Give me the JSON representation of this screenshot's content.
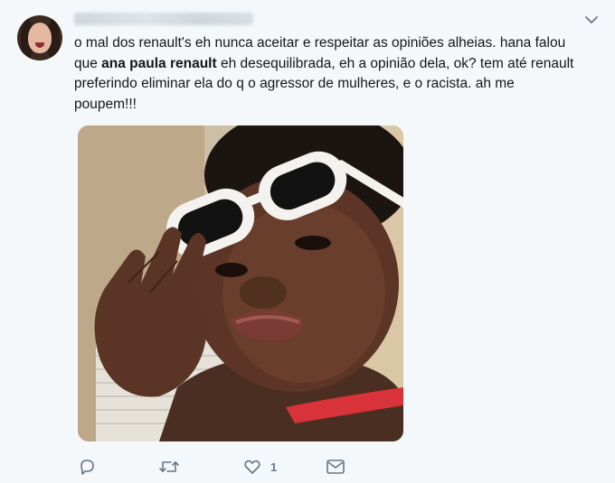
{
  "tweet": {
    "text_part1": "o mal dos renault's eh nunca aceitar e respeitar as opiniões alheias. hana falou\nque ",
    "text_bold": "ana paula renault",
    "text_part2": " eh desequilibrada, eh a opinião dela, ok? tem até renault\npreferindo eliminar ela do q o agressor de mulheres, e o racista. ah me\npoupem!!!",
    "like_count": "1",
    "icons": {
      "reply": "reply-icon",
      "retweet": "retweet-icon",
      "like": "heart-icon",
      "dm": "envelope-icon",
      "menu": "chevron-down-icon"
    },
    "colors": {
      "background": "#f5f8fa",
      "text": "#14171a",
      "icon": "#657786"
    }
  }
}
